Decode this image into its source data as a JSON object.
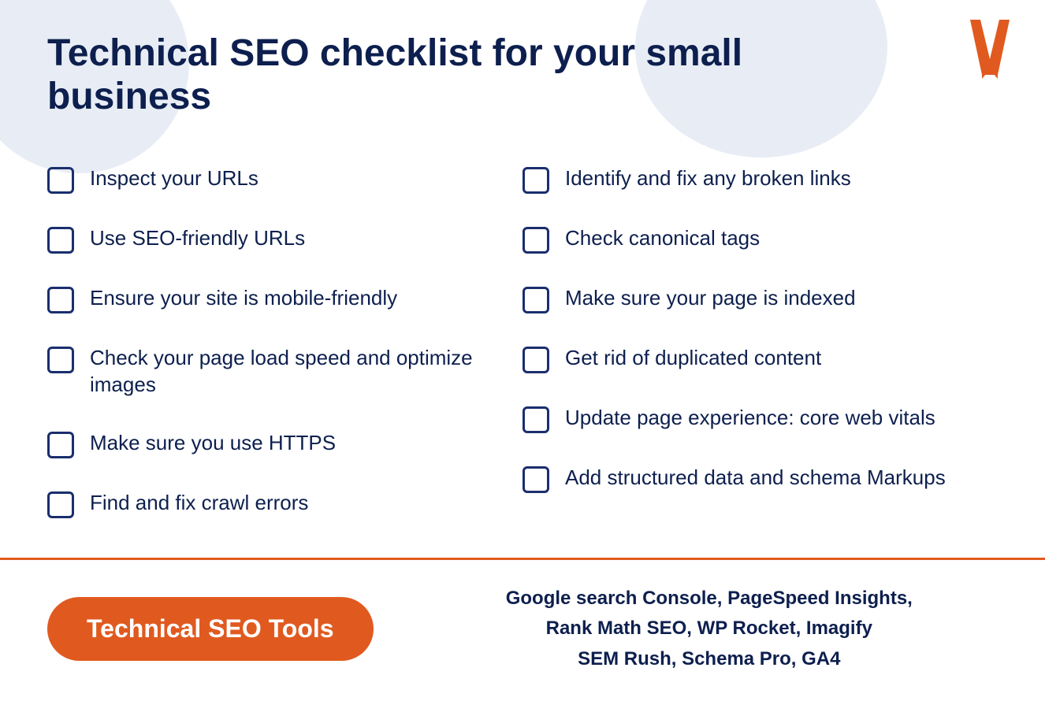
{
  "page": {
    "title": "Technical SEO checklist for your small business",
    "bg_color": "#ffffff"
  },
  "logo": {
    "alt": "W logo"
  },
  "checklist": {
    "left_column": [
      {
        "id": 1,
        "text": "Inspect your URLs"
      },
      {
        "id": 2,
        "text": "Use SEO-friendly URLs"
      },
      {
        "id": 3,
        "text": "Ensure your site is mobile-friendly"
      },
      {
        "id": 4,
        "text": "Check your page load speed and optimize images"
      },
      {
        "id": 5,
        "text": "Make sure you use HTTPS"
      },
      {
        "id": 6,
        "text": "Find and fix crawl errors"
      }
    ],
    "right_column": [
      {
        "id": 7,
        "text": "Identify and fix any broken links"
      },
      {
        "id": 8,
        "text": "Check canonical tags"
      },
      {
        "id": 9,
        "text": "Make sure your page is indexed"
      },
      {
        "id": 10,
        "text": "Get rid of duplicated content"
      },
      {
        "id": 11,
        "text": "Update page experience: core web vitals"
      },
      {
        "id": 12,
        "text": "Add structured data and schema Markups"
      }
    ]
  },
  "footer": {
    "badge_label": "Technical SEO Tools",
    "tools_line1": "Google search Console, PageSpeed Insights,",
    "tools_line2": "Rank Math SEO, WP Rocket, Imagify",
    "tools_line3": "SEM Rush, Schema Pro, GA4"
  }
}
